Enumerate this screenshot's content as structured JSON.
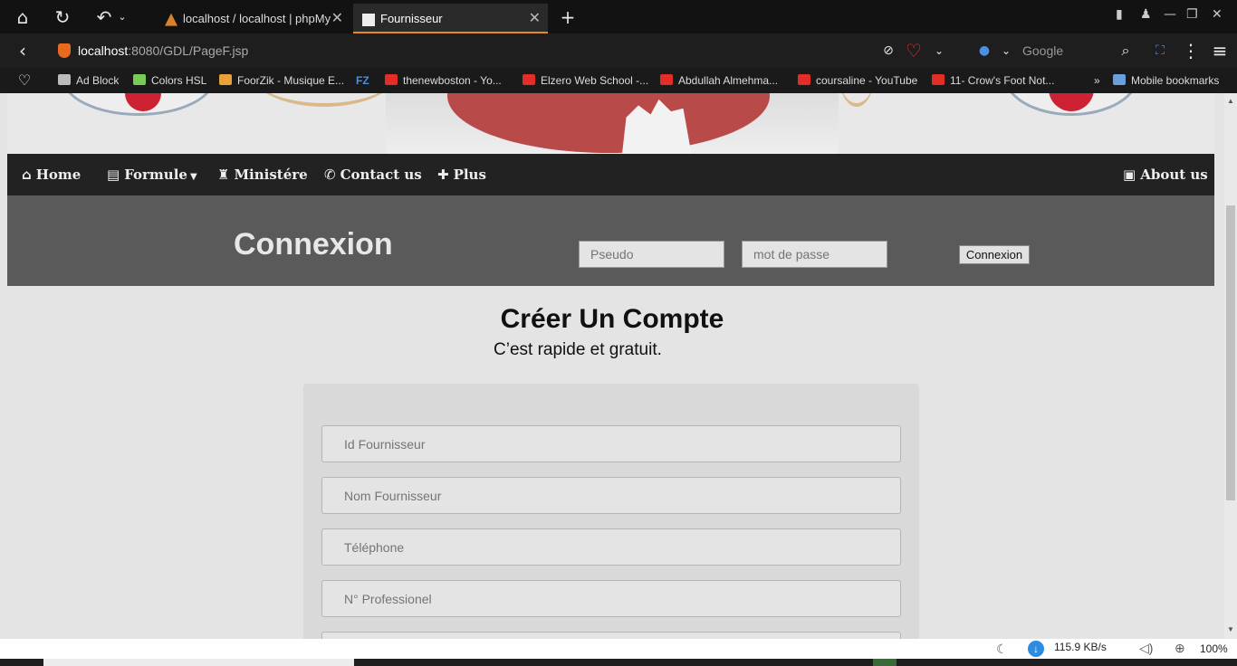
{
  "browser": {
    "tabs": [
      {
        "title": "localhost / localhost | phpMy"
      },
      {
        "title": "Fournisseur"
      }
    ],
    "url_host": "localhost",
    "url_rest": ":8080/GDL/PageF.jsp",
    "search_placeholder": "Google",
    "bookmarks": [
      "Ad Block",
      "Colors HSL",
      "FoorZik - Musique E...",
      "FZ",
      "thenewboston - Yo...",
      "Elzero Web School -...",
      "Abdullah Almehma...",
      "coursaline - YouTube",
      "11- Crow's Foot Not...",
      "»",
      "Mobile bookmarks"
    ],
    "download_speed": "115.9 KB/s",
    "zoom": "100%"
  },
  "nav": {
    "home": "Home",
    "formule": "Formule",
    "ministere": "Ministére",
    "contact": "Contact us",
    "plus": "Plus",
    "about": "About us"
  },
  "login": {
    "title": "Connexion",
    "pseudo_placeholder": "Pseudo",
    "password_placeholder": "mot de passe",
    "button": "Connexion"
  },
  "signup": {
    "title": "Créer Un Compte",
    "subtitle": "C’est rapide et gratuit.",
    "fields": [
      "Id Fournisseur",
      "Nom Fournisseur",
      "Téléphone",
      "N° Professionel"
    ]
  },
  "colors": {
    "navbar": "#222222",
    "loginbar": "#5a5a5a",
    "tab_accent": "#e58a2a"
  }
}
